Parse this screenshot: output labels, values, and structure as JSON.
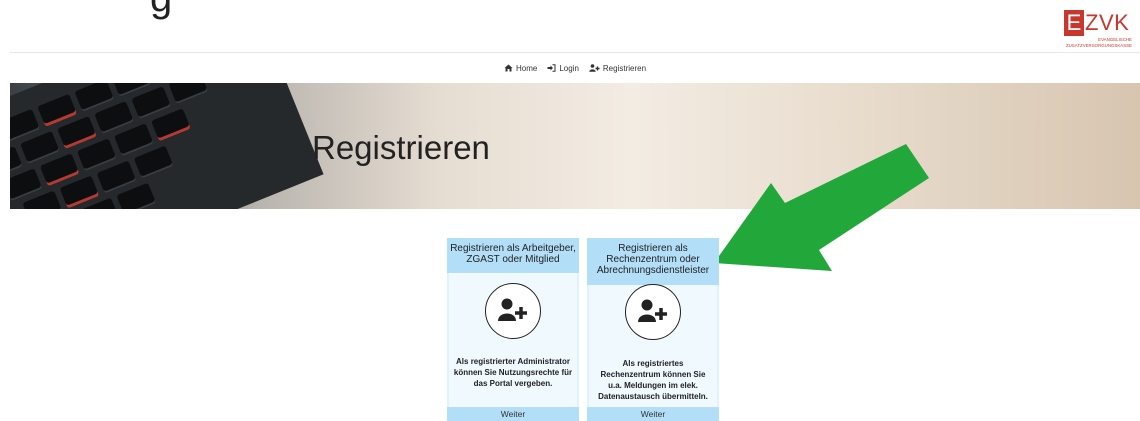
{
  "page": {
    "heading_partial": "g"
  },
  "logo": {
    "letter_e": "E",
    "letters_zvk": "ZVK",
    "subtitle_line1": "EVANGELISCHE",
    "subtitle_line2": "ZUSATZVERSORGUNGSKASSE",
    "colors": {
      "red": "#c8372d"
    }
  },
  "nav": {
    "items": [
      {
        "label": "Home",
        "icon": "home-icon"
      },
      {
        "label": "Login",
        "icon": "login-icon"
      },
      {
        "label": "Registrieren",
        "icon": "user-plus-icon"
      }
    ]
  },
  "hero": {
    "title": "Registrieren"
  },
  "annotation": {
    "icon": "green-arrow-icon",
    "color": "#22a83a"
  },
  "cards": [
    {
      "title": "Registrieren als Arbeitgeber, ZGAST oder Mitglied",
      "icon": "user-plus-icon",
      "description": "Als registrierter Administrator können Sie Nutzungsrechte für das Portal vergeben.",
      "button": "Weiter"
    },
    {
      "title": "Registrieren als Rechenzentrum oder Abrechnungsdienstleister",
      "icon": "user-plus-icon",
      "description": "Als registriertes Rechenzentrum können Sie u.a. Meldungen im elek. Datenaustausch übermitteln.",
      "button": "Weiter"
    }
  ],
  "colors": {
    "card_header": "#b2dff7",
    "card_body": "#e0f2fd"
  }
}
